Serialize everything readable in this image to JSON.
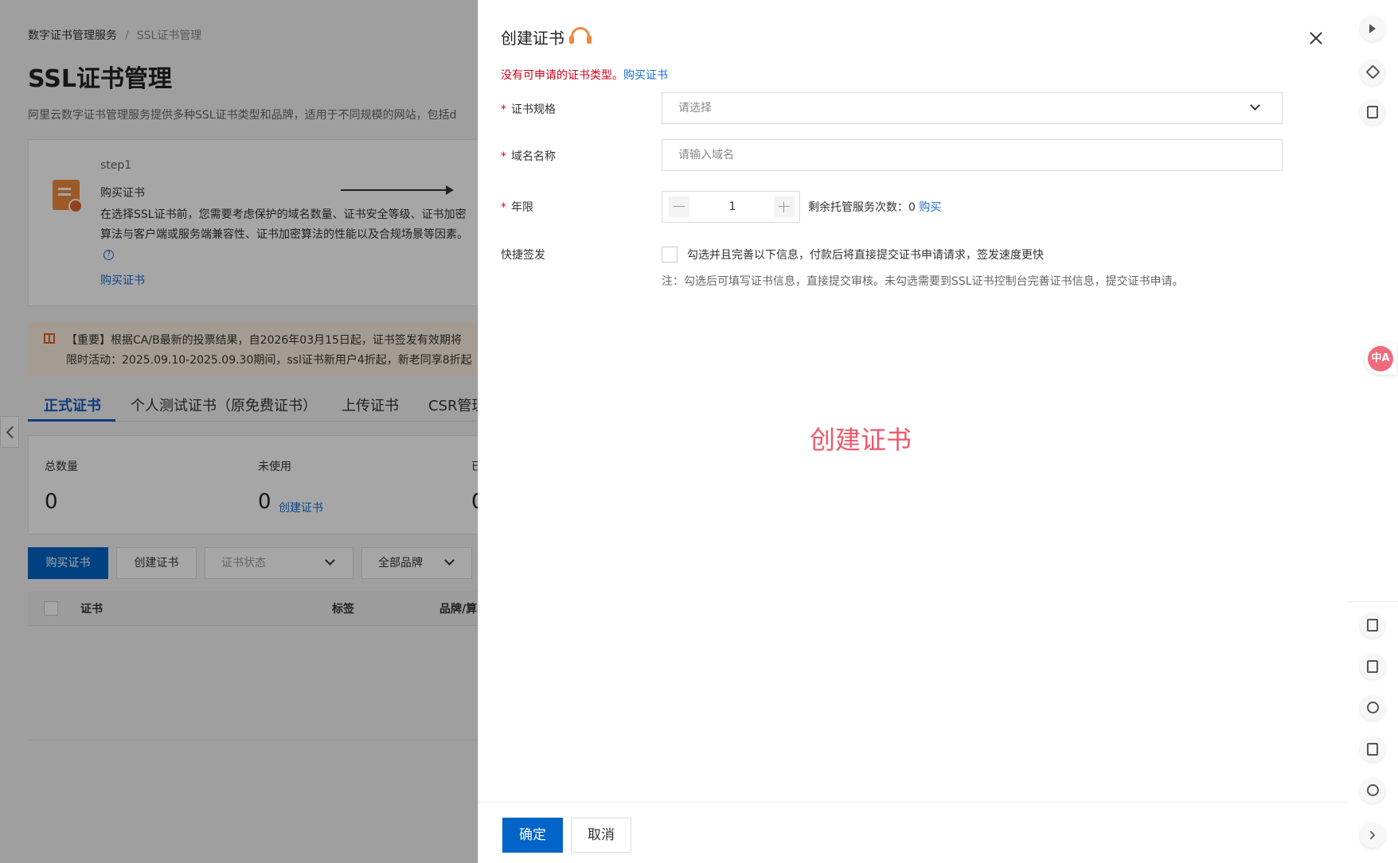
{
  "background": {
    "breadcrumb": {
      "root": "数字证书管理服务",
      "separator": "/",
      "current": "SSL证书管理"
    },
    "title": "SSL证书管理",
    "description": "阿里云数字证书管理服务提供多种SSL证书类型和品牌，适用于不同规模的网站，包括d",
    "step": {
      "no": "step1",
      "name": "购买证书",
      "text": "在选择SSL证书前，您需要考虑保护的域名数量、证书安全等级、证书加密算法与客户端或服务端兼容性、证书加密算法的性能以及合规场景等因素。",
      "help": "?",
      "link": "购买证书"
    },
    "notice": {
      "line1": "【重要】根据CA/B最新的投票结果，自2026年03月15日起，证书签发有效期将",
      "line2": "限时活动：2025.09.10-2025.09.30期间，ssl证书新用户4折起，新老同享8折起"
    },
    "tabs": [
      "正式证书",
      "个人测试证书（原免费证书）",
      "上传证书",
      "CSR管理"
    ],
    "stats": {
      "total_label": "总数量",
      "total_value": "0",
      "unused_label": "未使用",
      "unused_value": "0",
      "unused_link": "创建证书",
      "third_label": "已",
      "third_value": "0"
    },
    "toolbar": {
      "buy": "购买证书",
      "create": "创建证书",
      "status_placeholder": "证书状态",
      "brand_select": "全部品牌"
    },
    "table": {
      "headers": [
        "证书",
        "标签",
        "品牌/算"
      ]
    }
  },
  "drawer": {
    "title": "创建证书",
    "warning": "没有可申请的证书类型。",
    "warning_link": "购买证书",
    "fields": {
      "spec_label": "证书规格",
      "spec_placeholder": "请选择",
      "domain_label": "域名名称",
      "domain_placeholder": "请输入域名",
      "years_label": "年限",
      "years_value": "1",
      "remain_text": "剩余托管服务次数：0",
      "remain_link": "购买",
      "quick_label": "快捷签发",
      "quick_text": "勾选并且完善以下信息，付款后将直接提交证书申请请求，签发速度更快",
      "quick_note": "注：勾选后可填写证书信息，直接提交审核。未勾选需要到SSL证书控制台完善证书信息，提交证书申请。"
    },
    "watermark": "创建证书",
    "ok": "确定",
    "cancel": "取消"
  },
  "rail": {
    "translate": "中A"
  },
  "colors": {
    "primary": "#0064c8",
    "link": "#1a6fd0",
    "error": "#d0021b",
    "accent": "#f08a3e",
    "watermark": "#f0566a"
  }
}
